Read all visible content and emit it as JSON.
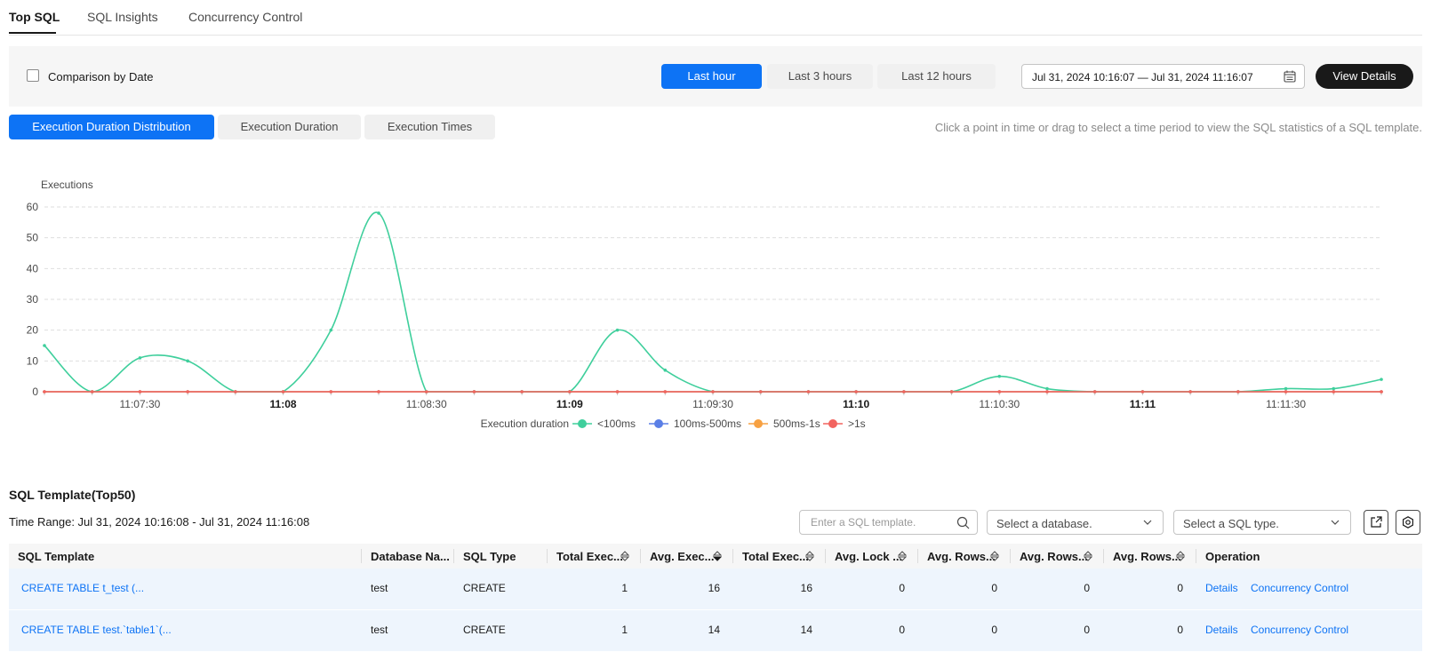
{
  "tabs": [
    {
      "label": "Top SQL",
      "active": true
    },
    {
      "label": "SQL Insights",
      "active": false
    },
    {
      "label": "Concurrency Control",
      "active": false
    }
  ],
  "toolbar": {
    "comparison_label": "Comparison by Date",
    "comparison_checked": false,
    "ranges": [
      {
        "label": "Last hour",
        "active": true
      },
      {
        "label": "Last 3 hours",
        "active": false
      },
      {
        "label": "Last 12 hours",
        "active": false
      }
    ],
    "date_range": "Jul 31, 2024 10:16:07 — Jul 31, 2024 11:16:07",
    "view_details": "View Details"
  },
  "chart_tabs": [
    {
      "label": "Execution Duration Distribution",
      "active": true
    },
    {
      "label": "Execution Duration",
      "active": false
    },
    {
      "label": "Execution Times",
      "active": false
    }
  ],
  "hint": "Click a point in time or drag to select a time period to view the SQL statistics of a SQL template.",
  "chart_data": {
    "type": "line",
    "title": "",
    "ylabel": "Executions",
    "xlabel": "",
    "ylim": [
      0,
      60
    ],
    "y_ticks": [
      0,
      10,
      20,
      30,
      40,
      50,
      60
    ],
    "x_ticks": [
      {
        "label": "11:07:30",
        "bold": false,
        "index": 2
      },
      {
        "label": "11:08",
        "bold": true,
        "index": 5
      },
      {
        "label": "11:08:30",
        "bold": false,
        "index": 8
      },
      {
        "label": "11:09",
        "bold": true,
        "index": 11
      },
      {
        "label": "11:09:30",
        "bold": false,
        "index": 14
      },
      {
        "label": "11:10",
        "bold": true,
        "index": 17
      },
      {
        "label": "11:10:30",
        "bold": false,
        "index": 20
      },
      {
        "label": "11:11",
        "bold": true,
        "index": 23
      },
      {
        "label": "11:11:30",
        "bold": false,
        "index": 26
      }
    ],
    "point_count": 28,
    "grid": true,
    "legend_title": "Execution duration",
    "legend_position": "bottom",
    "series": [
      {
        "name": "<100ms",
        "color": "#3fcf9c",
        "values": [
          15,
          0,
          11,
          10,
          0,
          0,
          20,
          58,
          0,
          0,
          0,
          0,
          20,
          7,
          0,
          0,
          0,
          0,
          0,
          0,
          5,
          1,
          0,
          0,
          0,
          0,
          1,
          1,
          4
        ]
      },
      {
        "name": "100ms-500ms",
        "color": "#5a7fe6",
        "values": [
          0,
          0,
          0,
          0,
          0,
          0,
          0,
          0,
          0,
          0,
          0,
          0,
          0,
          0,
          0,
          0,
          0,
          0,
          0,
          0,
          0,
          0,
          0,
          0,
          0,
          0,
          0,
          0,
          0
        ]
      },
      {
        "name": "500ms-1s",
        "color": "#f7a142",
        "values": [
          0,
          0,
          0,
          0,
          0,
          0,
          0,
          0,
          0,
          0,
          0,
          0,
          0,
          0,
          0,
          0,
          0,
          0,
          0,
          0,
          0,
          0,
          0,
          0,
          0,
          0,
          0,
          0,
          0
        ]
      },
      {
        "name": ">1s",
        "color": "#f2645f",
        "values": [
          0,
          0,
          0,
          0,
          0,
          0,
          0,
          0,
          0,
          0,
          0,
          0,
          0,
          0,
          0,
          0,
          0,
          0,
          0,
          0,
          0,
          0,
          0,
          0,
          0,
          0,
          0,
          0,
          0
        ]
      }
    ]
  },
  "templates": {
    "title": "SQL Template(Top50)",
    "time_range": "Time Range: Jul 31, 2024 10:16:08 - Jul 31, 2024 11:16:08",
    "search_placeholder": "Enter a SQL template.",
    "db_placeholder": "Select a database.",
    "type_placeholder": "Select a SQL type.",
    "columns": [
      "SQL Template",
      "Database Na...",
      "SQL Type",
      "Total Exec...",
      "Avg. Exec...",
      "Total Exec...",
      "Avg. Lock ...",
      "Avg. Rows...",
      "Avg. Rows...",
      "Avg. Rows...",
      "Operation"
    ],
    "rows": [
      {
        "template": "CREATE TABLE t_test (...",
        "database": "test",
        "type": "CREATE",
        "total_exec_count": "1",
        "avg_exec": "16",
        "total_exec": "16",
        "avg_lock": "0",
        "avg_rows_1": "0",
        "avg_rows_2": "0",
        "avg_rows_3": "0",
        "details": "Details",
        "cc": "Concurrency Control"
      },
      {
        "template": "CREATE TABLE test.`table1`(...",
        "database": "test",
        "type": "CREATE",
        "total_exec_count": "1",
        "avg_exec": "14",
        "total_exec": "14",
        "avg_lock": "0",
        "avg_rows_1": "0",
        "avg_rows_2": "0",
        "avg_rows_3": "0",
        "details": "Details",
        "cc": "Concurrency Control"
      }
    ]
  }
}
